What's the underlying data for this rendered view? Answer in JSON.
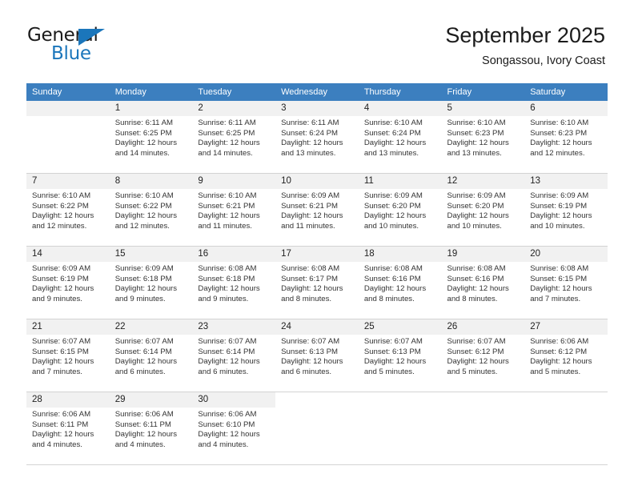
{
  "brand": {
    "name_top": "General",
    "name_bottom": "Blue",
    "triangle_color": "#1b76bb",
    "text_color": "#1b1b1b"
  },
  "header": {
    "title": "September 2025",
    "subtitle": "Songassou, Ivory Coast"
  },
  "theme": {
    "header_band": "#3c7fbf",
    "daynum_band": "#f1f1f1",
    "row_divider": "#d3d3d3",
    "body_text": "#333333"
  },
  "columns": [
    "Sunday",
    "Monday",
    "Tuesday",
    "Wednesday",
    "Thursday",
    "Friday",
    "Saturday"
  ],
  "labels": {
    "sunrise_prefix": "Sunrise:",
    "sunset_prefix": "Sunset:",
    "daylight_prefix": "Daylight:"
  },
  "weeks": [
    [
      {
        "day": "",
        "sunrise": "",
        "sunset": "",
        "daylight_line1": "",
        "daylight_line2": ""
      },
      {
        "day": "1",
        "sunrise": "Sunrise: 6:11 AM",
        "sunset": "Sunset: 6:25 PM",
        "daylight_line1": "Daylight: 12 hours",
        "daylight_line2": "and 14 minutes."
      },
      {
        "day": "2",
        "sunrise": "Sunrise: 6:11 AM",
        "sunset": "Sunset: 6:25 PM",
        "daylight_line1": "Daylight: 12 hours",
        "daylight_line2": "and 14 minutes."
      },
      {
        "day": "3",
        "sunrise": "Sunrise: 6:11 AM",
        "sunset": "Sunset: 6:24 PM",
        "daylight_line1": "Daylight: 12 hours",
        "daylight_line2": "and 13 minutes."
      },
      {
        "day": "4",
        "sunrise": "Sunrise: 6:10 AM",
        "sunset": "Sunset: 6:24 PM",
        "daylight_line1": "Daylight: 12 hours",
        "daylight_line2": "and 13 minutes."
      },
      {
        "day": "5",
        "sunrise": "Sunrise: 6:10 AM",
        "sunset": "Sunset: 6:23 PM",
        "daylight_line1": "Daylight: 12 hours",
        "daylight_line2": "and 13 minutes."
      },
      {
        "day": "6",
        "sunrise": "Sunrise: 6:10 AM",
        "sunset": "Sunset: 6:23 PM",
        "daylight_line1": "Daylight: 12 hours",
        "daylight_line2": "and 12 minutes."
      }
    ],
    [
      {
        "day": "7",
        "sunrise": "Sunrise: 6:10 AM",
        "sunset": "Sunset: 6:22 PM",
        "daylight_line1": "Daylight: 12 hours",
        "daylight_line2": "and 12 minutes."
      },
      {
        "day": "8",
        "sunrise": "Sunrise: 6:10 AM",
        "sunset": "Sunset: 6:22 PM",
        "daylight_line1": "Daylight: 12 hours",
        "daylight_line2": "and 12 minutes."
      },
      {
        "day": "9",
        "sunrise": "Sunrise: 6:10 AM",
        "sunset": "Sunset: 6:21 PM",
        "daylight_line1": "Daylight: 12 hours",
        "daylight_line2": "and 11 minutes."
      },
      {
        "day": "10",
        "sunrise": "Sunrise: 6:09 AM",
        "sunset": "Sunset: 6:21 PM",
        "daylight_line1": "Daylight: 12 hours",
        "daylight_line2": "and 11 minutes."
      },
      {
        "day": "11",
        "sunrise": "Sunrise: 6:09 AM",
        "sunset": "Sunset: 6:20 PM",
        "daylight_line1": "Daylight: 12 hours",
        "daylight_line2": "and 10 minutes."
      },
      {
        "day": "12",
        "sunrise": "Sunrise: 6:09 AM",
        "sunset": "Sunset: 6:20 PM",
        "daylight_line1": "Daylight: 12 hours",
        "daylight_line2": "and 10 minutes."
      },
      {
        "day": "13",
        "sunrise": "Sunrise: 6:09 AM",
        "sunset": "Sunset: 6:19 PM",
        "daylight_line1": "Daylight: 12 hours",
        "daylight_line2": "and 10 minutes."
      }
    ],
    [
      {
        "day": "14",
        "sunrise": "Sunrise: 6:09 AM",
        "sunset": "Sunset: 6:19 PM",
        "daylight_line1": "Daylight: 12 hours",
        "daylight_line2": "and 9 minutes."
      },
      {
        "day": "15",
        "sunrise": "Sunrise: 6:09 AM",
        "sunset": "Sunset: 6:18 PM",
        "daylight_line1": "Daylight: 12 hours",
        "daylight_line2": "and 9 minutes."
      },
      {
        "day": "16",
        "sunrise": "Sunrise: 6:08 AM",
        "sunset": "Sunset: 6:18 PM",
        "daylight_line1": "Daylight: 12 hours",
        "daylight_line2": "and 9 minutes."
      },
      {
        "day": "17",
        "sunrise": "Sunrise: 6:08 AM",
        "sunset": "Sunset: 6:17 PM",
        "daylight_line1": "Daylight: 12 hours",
        "daylight_line2": "and 8 minutes."
      },
      {
        "day": "18",
        "sunrise": "Sunrise: 6:08 AM",
        "sunset": "Sunset: 6:16 PM",
        "daylight_line1": "Daylight: 12 hours",
        "daylight_line2": "and 8 minutes."
      },
      {
        "day": "19",
        "sunrise": "Sunrise: 6:08 AM",
        "sunset": "Sunset: 6:16 PM",
        "daylight_line1": "Daylight: 12 hours",
        "daylight_line2": "and 8 minutes."
      },
      {
        "day": "20",
        "sunrise": "Sunrise: 6:08 AM",
        "sunset": "Sunset: 6:15 PM",
        "daylight_line1": "Daylight: 12 hours",
        "daylight_line2": "and 7 minutes."
      }
    ],
    [
      {
        "day": "21",
        "sunrise": "Sunrise: 6:07 AM",
        "sunset": "Sunset: 6:15 PM",
        "daylight_line1": "Daylight: 12 hours",
        "daylight_line2": "and 7 minutes."
      },
      {
        "day": "22",
        "sunrise": "Sunrise: 6:07 AM",
        "sunset": "Sunset: 6:14 PM",
        "daylight_line1": "Daylight: 12 hours",
        "daylight_line2": "and 6 minutes."
      },
      {
        "day": "23",
        "sunrise": "Sunrise: 6:07 AM",
        "sunset": "Sunset: 6:14 PM",
        "daylight_line1": "Daylight: 12 hours",
        "daylight_line2": "and 6 minutes."
      },
      {
        "day": "24",
        "sunrise": "Sunrise: 6:07 AM",
        "sunset": "Sunset: 6:13 PM",
        "daylight_line1": "Daylight: 12 hours",
        "daylight_line2": "and 6 minutes."
      },
      {
        "day": "25",
        "sunrise": "Sunrise: 6:07 AM",
        "sunset": "Sunset: 6:13 PM",
        "daylight_line1": "Daylight: 12 hours",
        "daylight_line2": "and 5 minutes."
      },
      {
        "day": "26",
        "sunrise": "Sunrise: 6:07 AM",
        "sunset": "Sunset: 6:12 PM",
        "daylight_line1": "Daylight: 12 hours",
        "daylight_line2": "and 5 minutes."
      },
      {
        "day": "27",
        "sunrise": "Sunrise: 6:06 AM",
        "sunset": "Sunset: 6:12 PM",
        "daylight_line1": "Daylight: 12 hours",
        "daylight_line2": "and 5 minutes."
      }
    ],
    [
      {
        "day": "28",
        "sunrise": "Sunrise: 6:06 AM",
        "sunset": "Sunset: 6:11 PM",
        "daylight_line1": "Daylight: 12 hours",
        "daylight_line2": "and 4 minutes."
      },
      {
        "day": "29",
        "sunrise": "Sunrise: 6:06 AM",
        "sunset": "Sunset: 6:11 PM",
        "daylight_line1": "Daylight: 12 hours",
        "daylight_line2": "and 4 minutes."
      },
      {
        "day": "30",
        "sunrise": "Sunrise: 6:06 AM",
        "sunset": "Sunset: 6:10 PM",
        "daylight_line1": "Daylight: 12 hours",
        "daylight_line2": "and 4 minutes."
      },
      {
        "day": "",
        "sunrise": "",
        "sunset": "",
        "daylight_line1": "",
        "daylight_line2": ""
      },
      {
        "day": "",
        "sunrise": "",
        "sunset": "",
        "daylight_line1": "",
        "daylight_line2": ""
      },
      {
        "day": "",
        "sunrise": "",
        "sunset": "",
        "daylight_line1": "",
        "daylight_line2": ""
      },
      {
        "day": "",
        "sunrise": "",
        "sunset": "",
        "daylight_line1": "",
        "daylight_line2": ""
      }
    ]
  ]
}
